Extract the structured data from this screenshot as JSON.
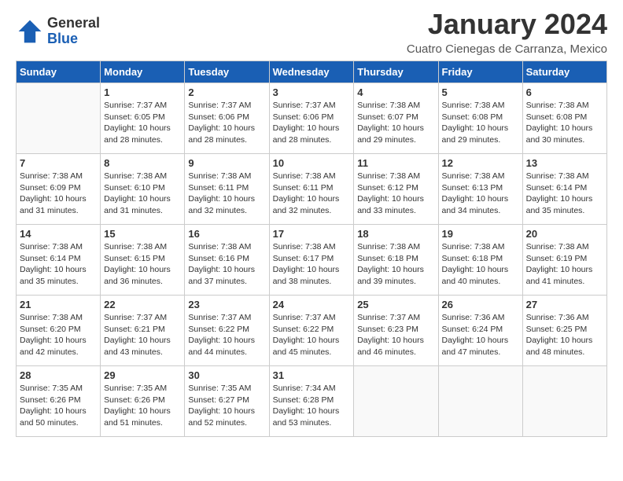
{
  "header": {
    "logo_general": "General",
    "logo_blue": "Blue",
    "month_title": "January 2024",
    "location": "Cuatro Cienegas de Carranza, Mexico"
  },
  "days_of_week": [
    "Sunday",
    "Monday",
    "Tuesday",
    "Wednesday",
    "Thursday",
    "Friday",
    "Saturday"
  ],
  "weeks": [
    [
      {
        "day": "",
        "info": ""
      },
      {
        "day": "1",
        "info": "Sunrise: 7:37 AM\nSunset: 6:05 PM\nDaylight: 10 hours and 28 minutes."
      },
      {
        "day": "2",
        "info": "Sunrise: 7:37 AM\nSunset: 6:06 PM\nDaylight: 10 hours and 28 minutes."
      },
      {
        "day": "3",
        "info": "Sunrise: 7:37 AM\nSunset: 6:06 PM\nDaylight: 10 hours and 28 minutes."
      },
      {
        "day": "4",
        "info": "Sunrise: 7:38 AM\nSunset: 6:07 PM\nDaylight: 10 hours and 29 minutes."
      },
      {
        "day": "5",
        "info": "Sunrise: 7:38 AM\nSunset: 6:08 PM\nDaylight: 10 hours and 29 minutes."
      },
      {
        "day": "6",
        "info": "Sunrise: 7:38 AM\nSunset: 6:08 PM\nDaylight: 10 hours and 30 minutes."
      }
    ],
    [
      {
        "day": "7",
        "info": "Sunrise: 7:38 AM\nSunset: 6:09 PM\nDaylight: 10 hours and 31 minutes."
      },
      {
        "day": "8",
        "info": "Sunrise: 7:38 AM\nSunset: 6:10 PM\nDaylight: 10 hours and 31 minutes."
      },
      {
        "day": "9",
        "info": "Sunrise: 7:38 AM\nSunset: 6:11 PM\nDaylight: 10 hours and 32 minutes."
      },
      {
        "day": "10",
        "info": "Sunrise: 7:38 AM\nSunset: 6:11 PM\nDaylight: 10 hours and 32 minutes."
      },
      {
        "day": "11",
        "info": "Sunrise: 7:38 AM\nSunset: 6:12 PM\nDaylight: 10 hours and 33 minutes."
      },
      {
        "day": "12",
        "info": "Sunrise: 7:38 AM\nSunset: 6:13 PM\nDaylight: 10 hours and 34 minutes."
      },
      {
        "day": "13",
        "info": "Sunrise: 7:38 AM\nSunset: 6:14 PM\nDaylight: 10 hours and 35 minutes."
      }
    ],
    [
      {
        "day": "14",
        "info": "Sunrise: 7:38 AM\nSunset: 6:14 PM\nDaylight: 10 hours and 35 minutes."
      },
      {
        "day": "15",
        "info": "Sunrise: 7:38 AM\nSunset: 6:15 PM\nDaylight: 10 hours and 36 minutes."
      },
      {
        "day": "16",
        "info": "Sunrise: 7:38 AM\nSunset: 6:16 PM\nDaylight: 10 hours and 37 minutes."
      },
      {
        "day": "17",
        "info": "Sunrise: 7:38 AM\nSunset: 6:17 PM\nDaylight: 10 hours and 38 minutes."
      },
      {
        "day": "18",
        "info": "Sunrise: 7:38 AM\nSunset: 6:18 PM\nDaylight: 10 hours and 39 minutes."
      },
      {
        "day": "19",
        "info": "Sunrise: 7:38 AM\nSunset: 6:18 PM\nDaylight: 10 hours and 40 minutes."
      },
      {
        "day": "20",
        "info": "Sunrise: 7:38 AM\nSunset: 6:19 PM\nDaylight: 10 hours and 41 minutes."
      }
    ],
    [
      {
        "day": "21",
        "info": "Sunrise: 7:38 AM\nSunset: 6:20 PM\nDaylight: 10 hours and 42 minutes."
      },
      {
        "day": "22",
        "info": "Sunrise: 7:37 AM\nSunset: 6:21 PM\nDaylight: 10 hours and 43 minutes."
      },
      {
        "day": "23",
        "info": "Sunrise: 7:37 AM\nSunset: 6:22 PM\nDaylight: 10 hours and 44 minutes."
      },
      {
        "day": "24",
        "info": "Sunrise: 7:37 AM\nSunset: 6:22 PM\nDaylight: 10 hours and 45 minutes."
      },
      {
        "day": "25",
        "info": "Sunrise: 7:37 AM\nSunset: 6:23 PM\nDaylight: 10 hours and 46 minutes."
      },
      {
        "day": "26",
        "info": "Sunrise: 7:36 AM\nSunset: 6:24 PM\nDaylight: 10 hours and 47 minutes."
      },
      {
        "day": "27",
        "info": "Sunrise: 7:36 AM\nSunset: 6:25 PM\nDaylight: 10 hours and 48 minutes."
      }
    ],
    [
      {
        "day": "28",
        "info": "Sunrise: 7:35 AM\nSunset: 6:26 PM\nDaylight: 10 hours and 50 minutes."
      },
      {
        "day": "29",
        "info": "Sunrise: 7:35 AM\nSunset: 6:26 PM\nDaylight: 10 hours and 51 minutes."
      },
      {
        "day": "30",
        "info": "Sunrise: 7:35 AM\nSunset: 6:27 PM\nDaylight: 10 hours and 52 minutes."
      },
      {
        "day": "31",
        "info": "Sunrise: 7:34 AM\nSunset: 6:28 PM\nDaylight: 10 hours and 53 minutes."
      },
      {
        "day": "",
        "info": ""
      },
      {
        "day": "",
        "info": ""
      },
      {
        "day": "",
        "info": ""
      }
    ]
  ]
}
